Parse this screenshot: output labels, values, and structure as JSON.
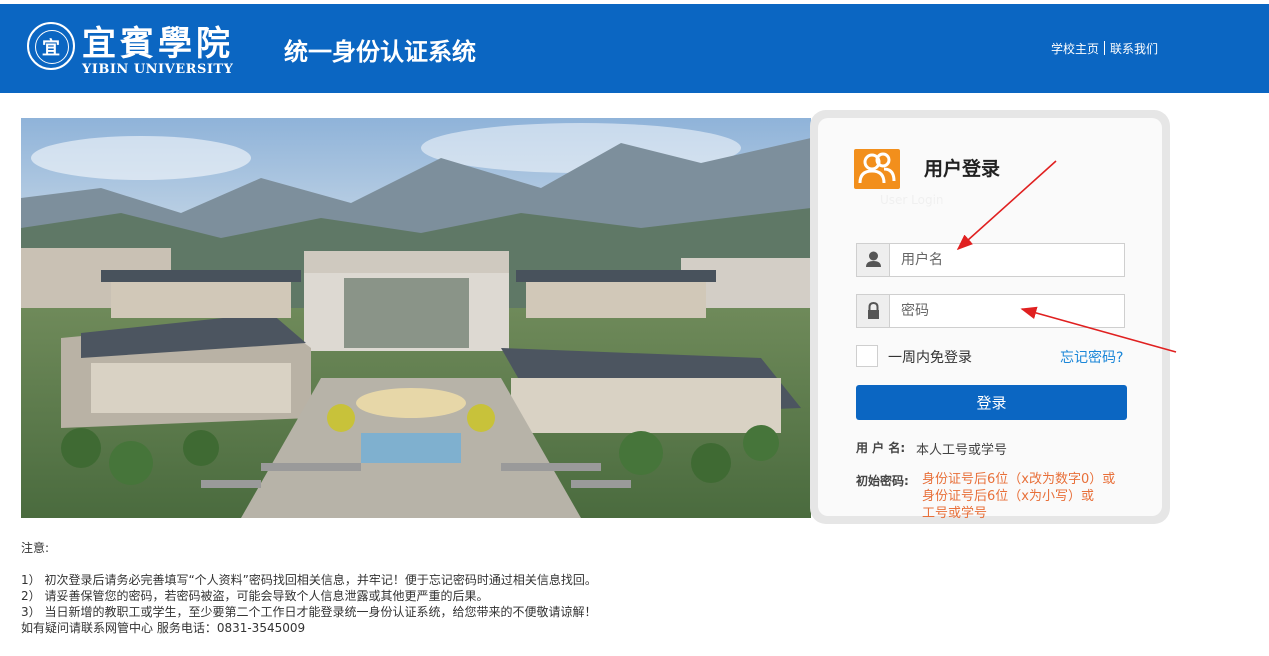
{
  "header": {
    "logo_seal_char": "宜",
    "school_name_cn": "宜賓學院",
    "school_name_en": "YIBIN UNIVERSITY",
    "system_title": "统一身份认证系统",
    "links": {
      "home": "学校主页",
      "contact": "联系我们"
    },
    "bg_color": "#0b66c2"
  },
  "login": {
    "title": "用户登录",
    "subtitle": "User Login",
    "username_placeholder": "用户名",
    "password_placeholder": "密码",
    "remember_label": "一周内免登录",
    "forgot_label": "忘记密码?",
    "submit_label": "登录",
    "username_hint_label": "用 户 名:",
    "username_hint_value": "本人工号或学号",
    "password_hint_label": "初始密码:",
    "password_hint_lines": [
      "身份证号后6位（x改为数字0）或",
      "身份证号后6位（x为小写）或",
      "工号或学号"
    ],
    "accent_color": "#0b66c2",
    "icon_color": "#f28f1c"
  },
  "notes": {
    "title": "注意:",
    "items": [
      "1） 初次登录后请务必完善填写“个人资料”密码找回相关信息，并牢记！便于忘记密码时通过相关信息找回。",
      "2） 请妥善保管您的密码，若密码被盗，可能会导致个人信息泄露或其他更严重的后果。",
      "3） 当日新增的教职工或学生，至少要第二个工作日才能登录统一身份认证系统，给您带来的不便敬请谅解！"
    ],
    "contact": "如有疑问请联系网管中心 服务电话：0831-3545009"
  },
  "icons": {
    "user_logo": "users-icon",
    "username_addon": "user-icon",
    "password_addon": "lock-icon"
  }
}
